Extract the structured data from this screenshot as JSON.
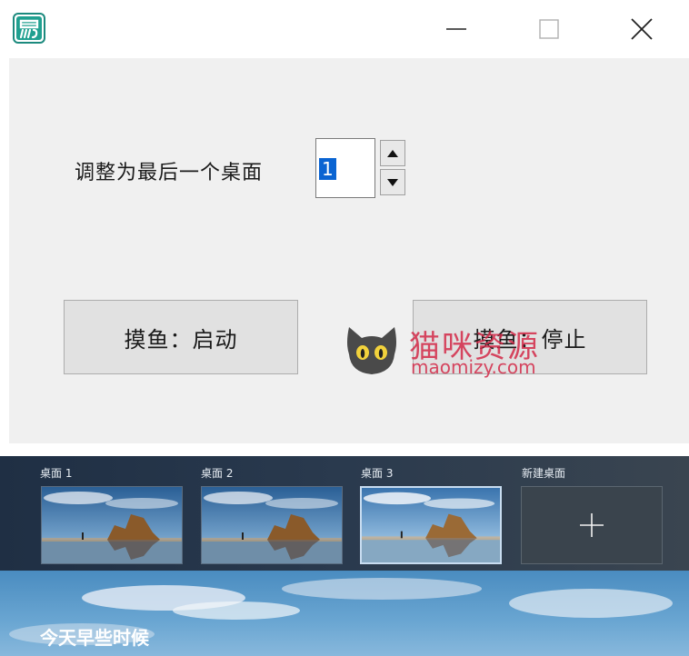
{
  "window": {
    "icon": "app-logo-icon",
    "controls": {
      "minimize": "minimize-icon",
      "maximize": "maximize-icon",
      "close": "close-icon"
    }
  },
  "form": {
    "label": "调整为最后一个桌面",
    "spin_value": "1",
    "start_button": "摸鱼：启动",
    "stop_button": "摸鱼：停止"
  },
  "watermark": {
    "text": "猫咪资源",
    "url": "maomizy.com"
  },
  "task_view": {
    "desktops": [
      {
        "label": "桌面 1",
        "active": false
      },
      {
        "label": "桌面 2",
        "active": false
      },
      {
        "label": "桌面 3",
        "active": true
      }
    ],
    "new_desktop_label": "新建桌面",
    "timeline_title": "今天早些时候"
  },
  "colors": {
    "accent_selection": "#0a64d2",
    "client_bg": "#f0f0f0",
    "watermark": "#d22846"
  }
}
